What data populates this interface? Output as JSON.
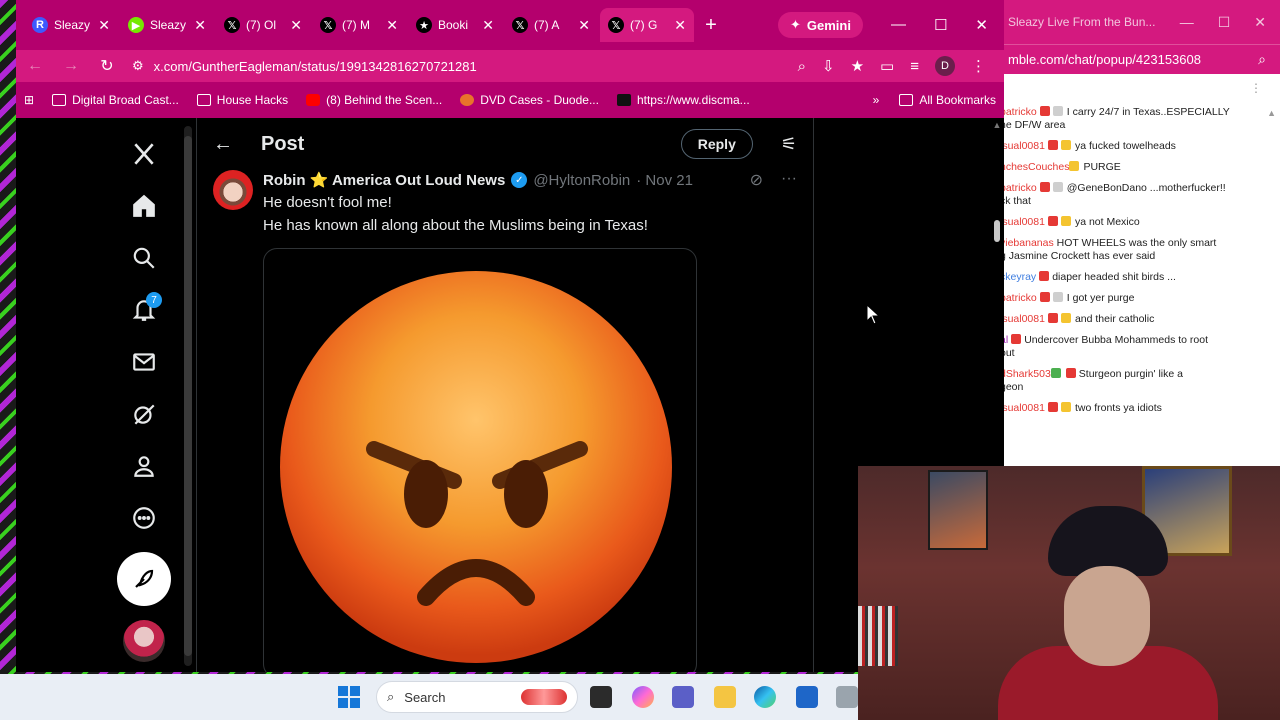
{
  "browser": {
    "tabs": [
      {
        "title": "Sleazy",
        "icon": "rumble-icon",
        "color": "#3d5afe",
        "glyph": "R"
      },
      {
        "title": "Sleazy",
        "icon": "rumble-play-icon",
        "color": "#75e900",
        "glyph": "▶"
      },
      {
        "title": "(7) Ol",
        "icon": "x-logo-icon",
        "color": "#000000",
        "glyph": "𝕏"
      },
      {
        "title": "(7) M",
        "icon": "x-logo-icon",
        "color": "#000000",
        "glyph": "𝕏"
      },
      {
        "title": "Booki",
        "icon": "star-icon",
        "color": "#000000",
        "glyph": "★"
      },
      {
        "title": "(7) A",
        "icon": "x-logo-icon",
        "color": "#000000",
        "glyph": "𝕏"
      },
      {
        "title": "(7) G",
        "icon": "x-logo-icon",
        "color": "#000000",
        "glyph": "𝕏"
      }
    ],
    "new_tab": "+",
    "gemini_label": "Gemini",
    "url": "x.com/GuntherEagleman/status/1991342816270721281",
    "profile_initial": "D",
    "bookmarks": [
      {
        "label": "Digital Broad Cast...",
        "icon": "folder-icon",
        "kind": ""
      },
      {
        "label": "House Hacks",
        "icon": "folder-icon",
        "kind": ""
      },
      {
        "label": "(8) Behind the Scen...",
        "icon": "youtube-icon",
        "kind": "yt"
      },
      {
        "label": "DVD Cases - Duode...",
        "icon": "dvd-icon",
        "kind": "dvd"
      },
      {
        "label": "https://www.discma...",
        "icon": "site-icon",
        "kind": "ds"
      }
    ],
    "bookmarks_more": "»",
    "all_bookmarks": "All Bookmarks"
  },
  "x": {
    "page_title": "Post",
    "reply_label": "Reply",
    "notification_count": "7",
    "tweet": {
      "name": "Robin ⭐ America Out Loud News",
      "handle": "@HyltonRobin",
      "date": "· Nov 21",
      "line1": "He doesn't fool me!",
      "line2": "He has known all along about the Muslims being in Texas!"
    }
  },
  "chat": {
    "window_title": "Sleazy Live From the Bun...",
    "url": "mble.com/chat/popup/423153608",
    "messages": [
      {
        "user": "patricko",
        "text": "I carry 24/7 in Texas..ESPECIALLY",
        "cont": "ne DF/W area",
        "user_color": "#e53935",
        "badges": "gray"
      },
      {
        "user": "isual0081",
        "text": "ya fucked towelheads",
        "cont": "",
        "user_color": "#e53935",
        "badges": "rumble"
      },
      {
        "user": "nchesCouches",
        "text": "PURGE",
        "cont": "",
        "user_color": "#e53935",
        "badges": "y"
      },
      {
        "user": "patricko",
        "text": "@GeneBonDano ...motherfucker!!",
        "cont": "ck that",
        "user_color": "#e53935",
        "badges": "gray"
      },
      {
        "user": "isual0081",
        "text": "ya not Mexico",
        "cont": "",
        "user_color": "#e53935",
        "badges": "rumble"
      },
      {
        "user": "viebananas",
        "text": "HOT WHEELS was the only smart",
        "cont": "g Jasmine Crockett has ever said",
        "user_color": "#e53935",
        "badges": "none"
      },
      {
        "user": "ckeyray",
        "text": "diaper headed shit birds ...",
        "cont": "",
        "user_color": "#3f7ee0",
        "badges": "r"
      },
      {
        "user": "patricko",
        "text": "I got yer purge",
        "cont": "",
        "user_color": "#e53935",
        "badges": "gray"
      },
      {
        "user": "isual0081",
        "text": "and their catholic",
        "cont": "",
        "user_color": "#e53935",
        "badges": "rumble"
      },
      {
        "user": "al",
        "text": "Undercover Bubba Mohammeds to root",
        "cont": "out",
        "user_color": "#9c27b0",
        "badges": "r"
      },
      {
        "user": "dShark503",
        "text": "Sturgeon purgin' like a",
        "cont": "geon",
        "user_color": "#e53935",
        "badges": "green"
      },
      {
        "user": "isual0081",
        "text": "two fronts ya idiots",
        "cont": "",
        "user_color": "#e53935",
        "badges": "rumble"
      }
    ]
  },
  "taskbar": {
    "search_placeholder": "Search"
  },
  "colors": {
    "browser_frame": "#b4006d",
    "browser_toolbar": "#d4197f",
    "x_blue": "#1d9bf0",
    "emoji_orange": "#f07a1e"
  }
}
